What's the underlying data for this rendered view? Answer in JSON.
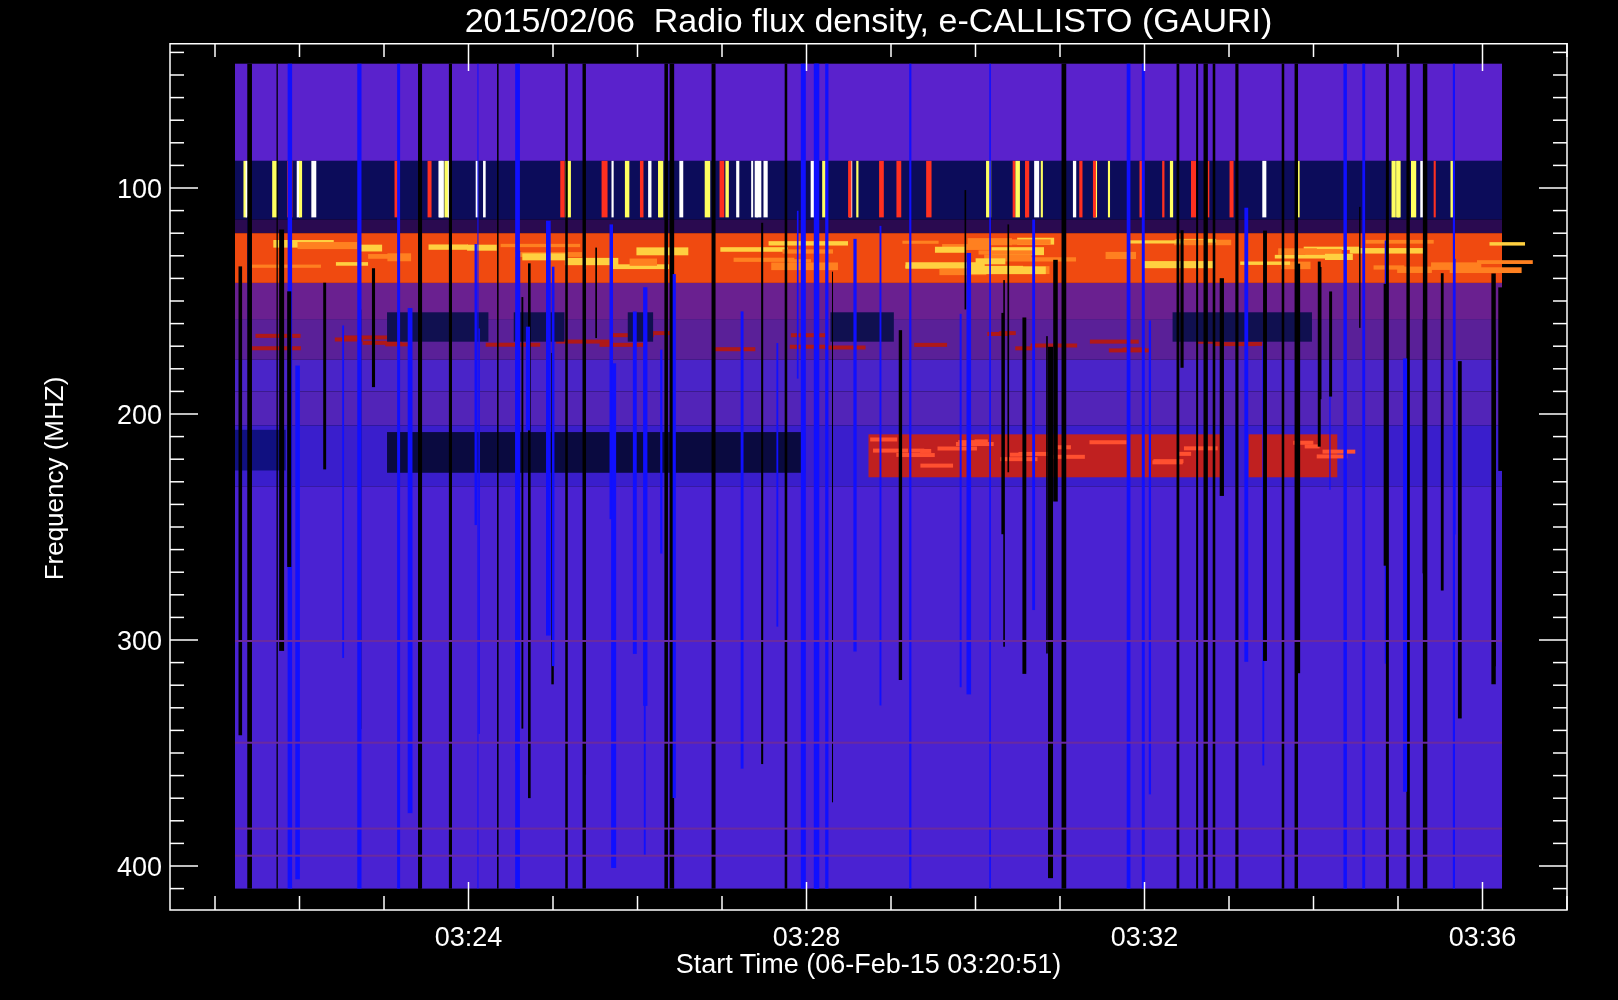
{
  "title": "2015/02/06  Radio flux density, e-CALLISTO (GAURI)",
  "y_axis": {
    "label": "Frequency (MHZ)",
    "ticks": [
      "100",
      "200",
      "300",
      "400"
    ]
  },
  "x_axis": {
    "label": "Start Time (06-Feb-15 03:20:51)",
    "ticks": [
      "03:24",
      "03:28",
      "03:32",
      "03:36"
    ]
  }
}
